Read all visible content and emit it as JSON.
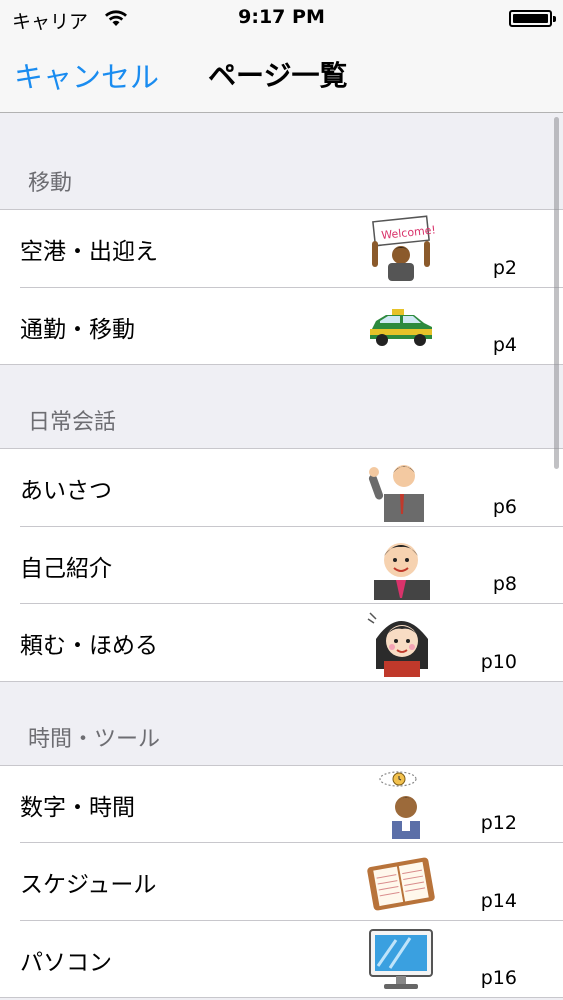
{
  "status_bar": {
    "carrier": "キャリア",
    "time": "9:17 PM"
  },
  "nav": {
    "cancel_label": "キャンセル",
    "title": "ページ一覧"
  },
  "sections": [
    {
      "title": "移動",
      "rows": [
        {
          "label": "空港・出迎え",
          "page": "p2",
          "icon": "welcome-sign-person-icon"
        },
        {
          "label": "通勤・移動",
          "page": "p4",
          "icon": "taxi-icon"
        }
      ]
    },
    {
      "title": "日常会話",
      "rows": [
        {
          "label": "あいさつ",
          "page": "p6",
          "icon": "waving-businessman-icon"
        },
        {
          "label": "自己紹介",
          "page": "p8",
          "icon": "smiling-businessman-icon"
        },
        {
          "label": "頼む・ほめる",
          "page": "p10",
          "icon": "smiling-woman-icon"
        }
      ]
    },
    {
      "title": "時間・ツール",
      "rows": [
        {
          "label": "数字・時間",
          "page": "p12",
          "icon": "clock-thinking-man-icon"
        },
        {
          "label": "スケジュール",
          "page": "p14",
          "icon": "planner-notebook-icon"
        },
        {
          "label": "パソコン",
          "page": "p16",
          "icon": "computer-monitor-icon"
        }
      ]
    }
  ],
  "colors": {
    "accent": "#1a8cf0",
    "section_bg": "#efeff4",
    "separator": "#c8c7cc"
  }
}
